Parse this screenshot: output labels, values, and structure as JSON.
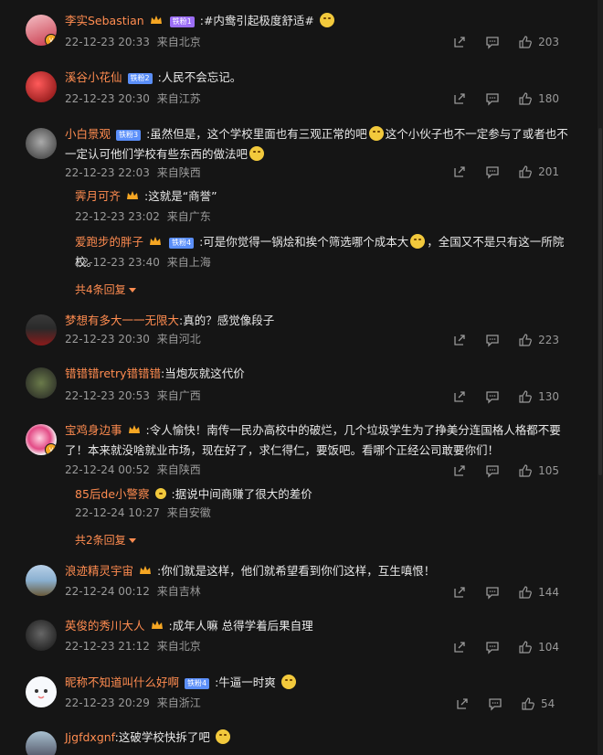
{
  "comments": [
    {
      "name": "李实Sebastian",
      "badge": "铁粉1",
      "badge_style": "purple",
      "crown": true,
      "text": ":#内鸯引起极度舒适#",
      "time": "22-12-23 20:33",
      "location": "来自北京",
      "likes": "203",
      "avatar_colors": [
        "#f4c0c6",
        "#c93a4c"
      ],
      "verified": true
    },
    {
      "name": "溪谷小花仙",
      "badge": "铁粉2",
      "text": ":人民不会忘记。",
      "time": "22-12-23 20:30",
      "location": "来自江苏",
      "likes": "180",
      "avatar_colors": [
        "#e03030",
        "#7a0c0c"
      ]
    },
    {
      "name": "小白景观",
      "badge": "铁粉3",
      "text1": ":虽然但是，这个学校里面也有三观正常的吧",
      "text2": "这个小伙子也不一定参与了或者也不一定认可他们学校有些东西的做法吧",
      "time": "22-12-23 22:03",
      "location": "来自陕西",
      "likes": "201",
      "avatar_colors": [
        "#777",
        "#333"
      ],
      "replies": [
        {
          "name": "霁月可齐",
          "crown": true,
          "text": ":这就是“商誉”",
          "time": "22-12-23 23:02",
          "location": "来自广东"
        },
        {
          "name": "爱跑步的胖子",
          "badge": "铁粉4",
          "crown": true,
          "text1": ":可是你觉得一锅烩和挨个筛选哪个成本大",
          "text2": "，全国又不是只有这一所院校。",
          "time": "22-12-23 23:40",
          "location": "来自上海"
        }
      ],
      "more": "共4条回复"
    },
    {
      "name": "梦想有多大一一无限大",
      "text": ":真的？感觉像段子",
      "time": "22-12-23 20:30",
      "location": "来自河北",
      "likes": "223",
      "avatar_colors": [
        "#2a2a2a",
        "#8a1a1a"
      ]
    },
    {
      "name": "错错错retry错错错",
      "text": ":当炮灰就这代价",
      "time": "22-12-23 20:53",
      "location": "来自广西",
      "likes": "130",
      "avatar_colors": [
        "#4a5a3a",
        "#222"
      ]
    },
    {
      "name": "宝鸡身边事",
      "crown": true,
      "text1": ":令人愉快！南传一民办高校中的破烂，几个垃圾学生为了挣美分连国格人格都不要了！本",
      "text2": "来就没啥就业市场，现在好了，求仁得仁，要饭吧。看哪个正经公司敢要你们！",
      "time": "22-12-24 00:52",
      "location": "来自陕西",
      "likes": "105",
      "avatar_colors": [
        "#f7f7f7",
        "#e34b86"
      ],
      "verified": true,
      "replies": [
        {
          "name": "85后de小警察",
          "crown_small": true,
          "text": ":据说中间商赚了很大的差价",
          "time": "22-12-24 10:27",
          "location": "来自安徽"
        }
      ],
      "more": "共2条回复"
    },
    {
      "name": "浪迹精灵宇宙",
      "crown": true,
      "text": ":你们就是这样，他们就希望看到你们这样，互生嗔恨！",
      "time": "22-12-24 00:12",
      "location": "来自吉林",
      "likes": "144",
      "avatar_colors": [
        "#8ab0d0",
        "#6a5a3a"
      ]
    },
    {
      "name": "英俊的秀川大人",
      "crown": true,
      "text": ":成年人嘛 总得学着后果自理",
      "time": "22-12-23 21:12",
      "location": "来自北京",
      "likes": "104",
      "avatar_colors": [
        "#222",
        "#555"
      ]
    },
    {
      "name": "昵称不知道叫什么好啊",
      "badge": "铁粉4",
      "text": ":牛逼一时爽",
      "time": "22-12-23 20:29",
      "location": "来自浙江",
      "likes": "54",
      "avatar_colors": [
        "#ffffff",
        "#dfe8f5"
      ]
    },
    {
      "name": "Jjgfdxgnf",
      "text": ":这破学校快拆了吧",
      "avatar_colors": [
        "#8aa0b0",
        "#445"
      ]
    }
  ]
}
